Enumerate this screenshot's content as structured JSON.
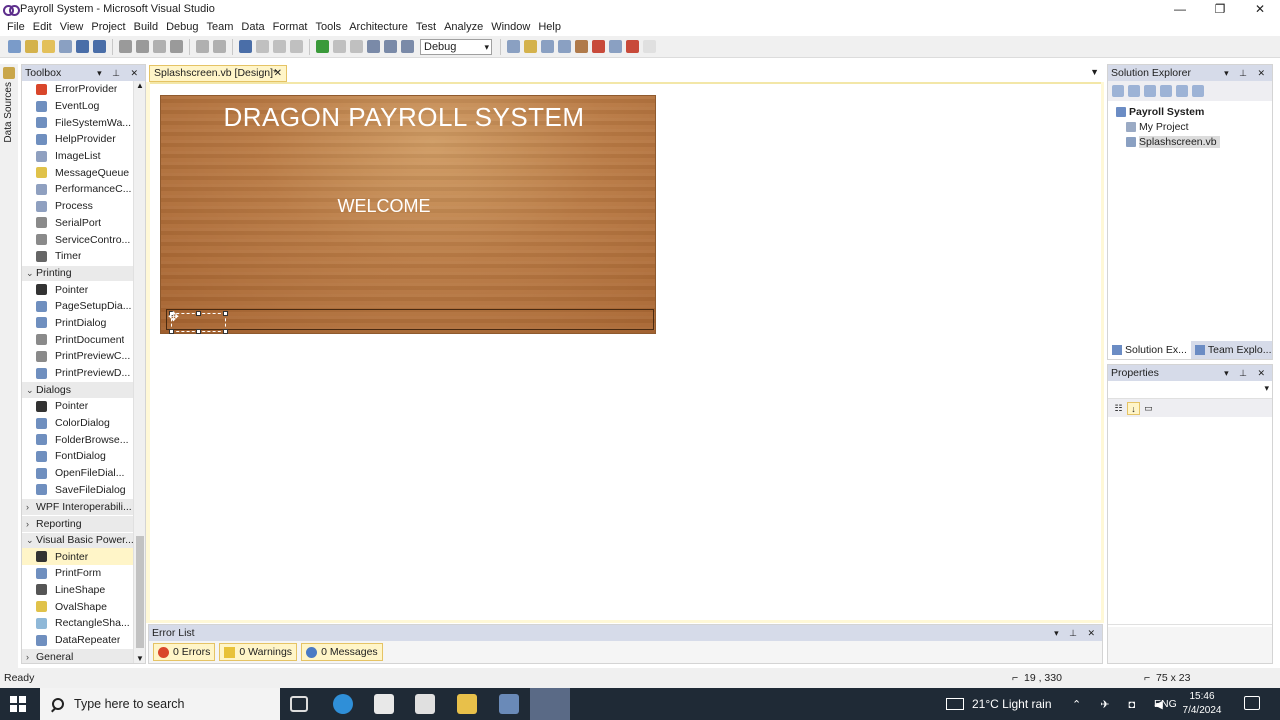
{
  "window": {
    "title": "Payroll System - Microsoft Visual Studio",
    "controls": [
      "—",
      "❐",
      "✕"
    ]
  },
  "menu": [
    "File",
    "Edit",
    "View",
    "Project",
    "Build",
    "Debug",
    "Team",
    "Data",
    "Format",
    "Tools",
    "Architecture",
    "Test",
    "Analyze",
    "Window",
    "Help"
  ],
  "toolbar": {
    "config": "Debug"
  },
  "side_tab": {
    "label": "Data Sources"
  },
  "toolbox": {
    "title": "Toolbox",
    "items": [
      {
        "kind": "item",
        "label": "ErrorProvider",
        "color": "#d9462b"
      },
      {
        "kind": "item",
        "label": "EventLog",
        "color": "#6f8fbf"
      },
      {
        "kind": "item",
        "label": "FileSystemWa...",
        "color": "#6f8fbf"
      },
      {
        "kind": "item",
        "label": "HelpProvider",
        "color": "#6f8fbf"
      },
      {
        "kind": "item",
        "label": "ImageList",
        "color": "#8fa0c0"
      },
      {
        "kind": "item",
        "label": "MessageQueue",
        "color": "#e0c24a"
      },
      {
        "kind": "item",
        "label": "PerformanceC...",
        "color": "#8fa0c0"
      },
      {
        "kind": "item",
        "label": "Process",
        "color": "#8fa0c0"
      },
      {
        "kind": "item",
        "label": "SerialPort",
        "color": "#8a8a8a"
      },
      {
        "kind": "item",
        "label": "ServiceContro...",
        "color": "#8a8a8a"
      },
      {
        "kind": "item",
        "label": "Timer",
        "color": "#666666"
      },
      {
        "kind": "cat",
        "label": "Printing",
        "open": true
      },
      {
        "kind": "item",
        "label": "Pointer",
        "color": "#333333"
      },
      {
        "kind": "item",
        "label": "PageSetupDia...",
        "color": "#6f8fbf"
      },
      {
        "kind": "item",
        "label": "PrintDialog",
        "color": "#6f8fbf"
      },
      {
        "kind": "item",
        "label": "PrintDocument",
        "color": "#8a8a8a"
      },
      {
        "kind": "item",
        "label": "PrintPreviewC...",
        "color": "#8a8a8a"
      },
      {
        "kind": "item",
        "label": "PrintPreviewD...",
        "color": "#6f8fbf"
      },
      {
        "kind": "cat",
        "label": "Dialogs",
        "open": true
      },
      {
        "kind": "item",
        "label": "Pointer",
        "color": "#333333"
      },
      {
        "kind": "item",
        "label": "ColorDialog",
        "color": "#6f8fbf"
      },
      {
        "kind": "item",
        "label": "FolderBrowse...",
        "color": "#6f8fbf"
      },
      {
        "kind": "item",
        "label": "FontDialog",
        "color": "#6f8fbf"
      },
      {
        "kind": "item",
        "label": "OpenFileDial...",
        "color": "#6f8fbf"
      },
      {
        "kind": "item",
        "label": "SaveFileDialog",
        "color": "#6f8fbf"
      },
      {
        "kind": "cat",
        "label": "WPF Interoperabili...",
        "open": false
      },
      {
        "kind": "cat",
        "label": "Reporting",
        "open": false
      },
      {
        "kind": "cat",
        "label": "Visual Basic Power...",
        "open": true
      },
      {
        "kind": "item",
        "label": "Pointer",
        "color": "#333333",
        "selected": true
      },
      {
        "kind": "item",
        "label": "PrintForm",
        "color": "#6f8fbf"
      },
      {
        "kind": "item",
        "label": "LineShape",
        "color": "#555555"
      },
      {
        "kind": "item",
        "label": "OvalShape",
        "color": "#e0c24a"
      },
      {
        "kind": "item",
        "label": "RectangleSha...",
        "color": "#8fb8d8"
      },
      {
        "kind": "item",
        "label": "DataRepeater",
        "color": "#6f8fbf"
      },
      {
        "kind": "cat",
        "label": "General",
        "open": false
      }
    ]
  },
  "editor": {
    "tab_label": "Splashscreen.vb [Design]*",
    "splash": {
      "title": "DRAGON PAYROLL SYSTEM",
      "subtitle": "WELCOME"
    }
  },
  "solution_explorer": {
    "title": "Solution Explorer",
    "tree": [
      "Payroll System",
      "My Project",
      "Splashscreen.vb"
    ],
    "tabs": [
      "Solution Ex...",
      "Team Explo..."
    ]
  },
  "properties": {
    "title": "Properties"
  },
  "error_list": {
    "title": "Error List",
    "errors": "0 Errors",
    "warnings": "0 Warnings",
    "messages": "0 Messages"
  },
  "status": {
    "text": "Ready",
    "position": "19 , 330",
    "size": "75 x 23"
  },
  "taskbar": {
    "search_placeholder": "Type here to search",
    "weather": "21°C  Light rain",
    "lang": "ENG",
    "time": "15:46",
    "date": "7/4/2024"
  }
}
